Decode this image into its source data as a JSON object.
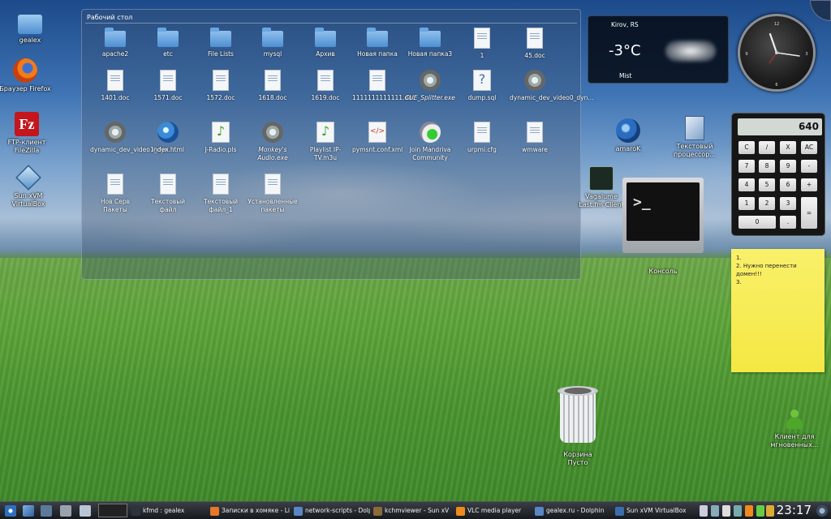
{
  "desktop_icons": [
    {
      "label": "gealex"
    },
    {
      "label": "Браузер Firefox"
    },
    {
      "label": "FTP-клиент FileZilla"
    },
    {
      "label": "Sun xVM VirtualBox"
    }
  ],
  "folder_view": {
    "title": "Рабочий стол",
    "items": [
      {
        "label": "apache2",
        "icon": "folder-icon"
      },
      {
        "label": "etc",
        "icon": "folder-icon"
      },
      {
        "label": "File Lists",
        "icon": "folder-icon"
      },
      {
        "label": "mysql",
        "icon": "folder-icon"
      },
      {
        "label": "Архив",
        "icon": "folder-icon"
      },
      {
        "label": "Новая папка",
        "icon": "folder-icon"
      },
      {
        "label": "Новая папка3",
        "icon": "folder-icon"
      },
      {
        "label": "1",
        "icon": "document-icon"
      },
      {
        "label": "45.doc",
        "icon": "document-icon"
      },
      {
        "label": "1401.doc",
        "icon": "document-icon"
      },
      {
        "label": "1571.doc",
        "icon": "document-icon"
      },
      {
        "label": "1572.doc",
        "icon": "document-icon"
      },
      {
        "label": "1618.doc",
        "icon": "document-icon"
      },
      {
        "label": "1619.doc",
        "icon": "document-icon"
      },
      {
        "label": "1111111111111.doc",
        "icon": "document-icon"
      },
      {
        "label": "CUE_Splitter.exe",
        "icon": "gear-icon"
      },
      {
        "label": "dump.sql",
        "icon": "question-document-icon"
      },
      {
        "label": "dynamic_dev_video0_dyn...",
        "icon": "gear-icon"
      },
      {
        "label": "dynamic_dev_video1_dyn...",
        "icon": "gear-icon"
      },
      {
        "label": "index.html",
        "icon": "globe-icon"
      },
      {
        "label": "J-Radio.pls",
        "icon": "music-document-icon"
      },
      {
        "label": "Monkey's Audio.exe",
        "icon": "gear-icon"
      },
      {
        "label": "Playlist IP-TV.m3u",
        "icon": "music-document-icon"
      },
      {
        "label": "pymsnt.conf.xml",
        "icon": "xml-document-icon"
      },
      {
        "label": "Join Mandriva Community",
        "icon": "mandriva-icon"
      },
      {
        "label": "urpmi.cfg",
        "icon": "document-icon"
      },
      {
        "label": "wmware",
        "icon": "document-icon"
      },
      {
        "label": "Нов Серв Пакеты",
        "icon": "document-icon"
      },
      {
        "label": "Текстовый файл",
        "icon": "document-icon"
      },
      {
        "label": "Текстовый файл_1",
        "icon": "document-icon"
      },
      {
        "label": "Установленные пакеты",
        "icon": "document-icon"
      }
    ]
  },
  "weather": {
    "city": "Kirov, RS",
    "temp": "-3°C",
    "condition": "Mist"
  },
  "calculator": {
    "display": "640",
    "keys": [
      "C",
      "/",
      "X",
      "AC",
      "7",
      "8",
      "9",
      "-",
      "4",
      "5",
      "6",
      "+",
      "1",
      "2",
      "3",
      "=",
      "0",
      "."
    ]
  },
  "note": {
    "lines": [
      "1.",
      "2. Нужно перенести домен!!!",
      "3."
    ]
  },
  "right_icons": [
    {
      "label": "amaroK"
    },
    {
      "label": "Текстовый процессор..."
    },
    {
      "label": "Vagalume Last.fm Client"
    },
    {
      "label": "Консоль"
    },
    {
      "label": "Корзина Пусто"
    },
    {
      "label": "Клиент для мгновенных..."
    }
  ],
  "konsole": {
    "prompt": ">_"
  },
  "taskbar": {
    "items": [
      {
        "label": "kfmd : gealex",
        "color": "#2e3340"
      },
      {
        "label": "Записки в хомяке - Li",
        "color": "#e8762b"
      },
      {
        "label": "network-scripts - Dolp",
        "color": "#5a86c2"
      },
      {
        "label": "kchmviewer - Sun xV",
        "color": "#8b6b3a"
      },
      {
        "label": "VLC media player",
        "color": "#f08a1c"
      },
      {
        "label": "gealex.ru - Dolphin",
        "color": "#5a86c2"
      },
      {
        "label": "Sun xVM VirtualBox",
        "color": "#3b6ea8"
      }
    ],
    "clock": "23:17"
  }
}
